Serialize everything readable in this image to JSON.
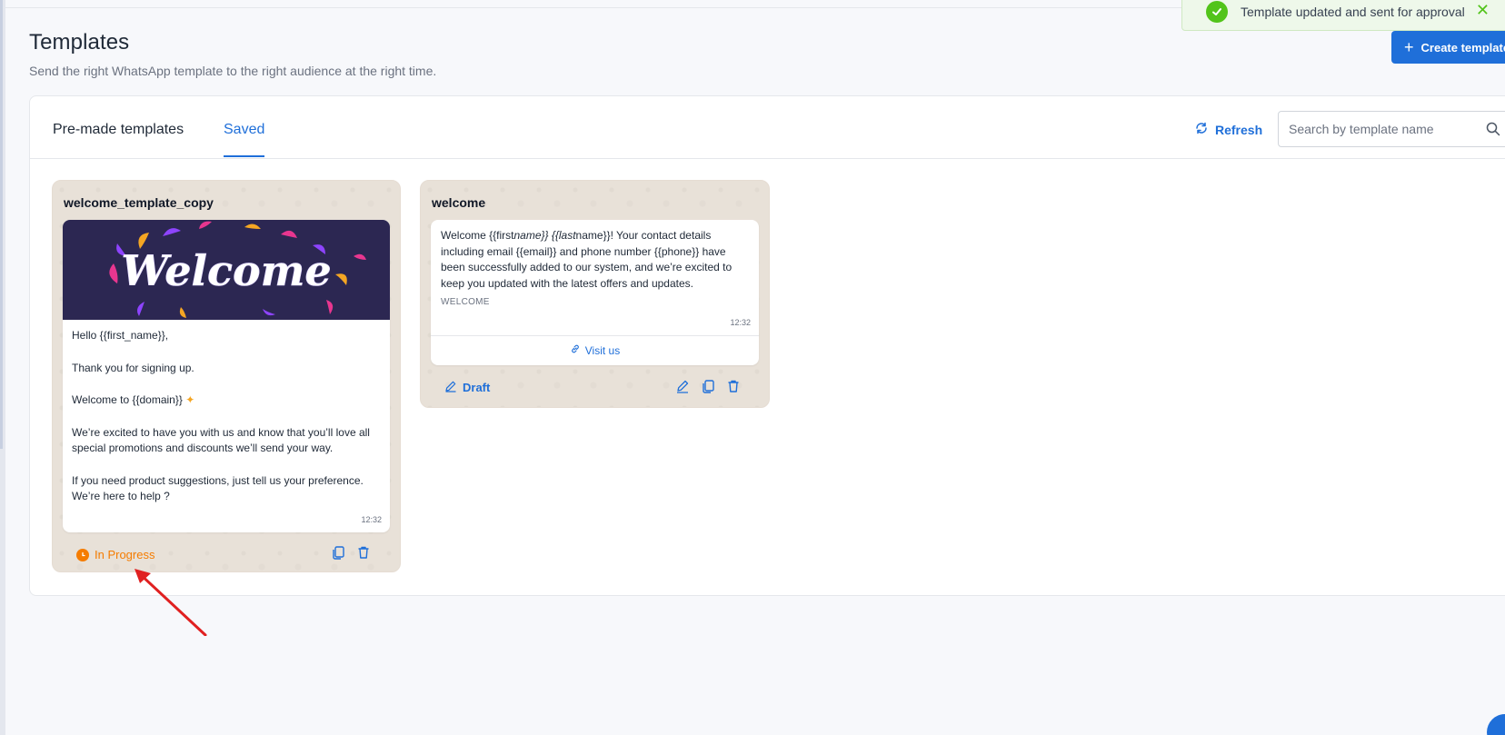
{
  "toast": {
    "message": "Template updated and sent for approval"
  },
  "header": {
    "title": "Templates",
    "subtitle": "Send the right WhatsApp template to the right audience at the right time.",
    "create_label": "Create template"
  },
  "tabs": [
    {
      "label": "Pre-made templates",
      "active": false
    },
    {
      "label": "Saved",
      "active": true
    }
  ],
  "toolbar": {
    "refresh_label": "Refresh",
    "search_placeholder": "Search by template name"
  },
  "templates": [
    {
      "name": "welcome_template_copy",
      "image_text": "Welcome",
      "lines": [
        "Hello {{first_name}},",
        "Thank you for signing up.",
        "Welcome to {{domain}}",
        "We’re excited to have you with us and know that you’ll love all special promotions and discounts we’ll send your way.",
        "If you need product suggestions, just tell us your preference. We’re here to help ?"
      ],
      "time": "12:32",
      "status": "In Progress"
    },
    {
      "name": "welcome",
      "body_prefix": "Welcome {{first",
      "body_italic": "name}} {{last",
      "body_suffix": "name}}! Your contact details including email {{email}} and phone number {{phone}} have been successfully added to our system, and we’re excited to keep you updated with the latest offers and updates.",
      "footer": "WELCOME",
      "time": "12:32",
      "button": "Visit us",
      "status": "Draft"
    }
  ],
  "colors": {
    "primary": "#1f6fd9",
    "in_progress": "#f57c00",
    "success": "#52c41a",
    "card_bg": "#e8e1d8",
    "arrow": "#e02020"
  },
  "icons": {
    "toast": "check-circle-icon",
    "close": "close-icon",
    "create": "plus-icon",
    "refresh": "refresh-icon",
    "search": "search-icon",
    "status_in_progress": "clock-icon",
    "draft": "pencil-icon",
    "edit": "edit-icon",
    "copy": "copy-icon",
    "delete": "trash-icon",
    "link": "link-icon"
  }
}
